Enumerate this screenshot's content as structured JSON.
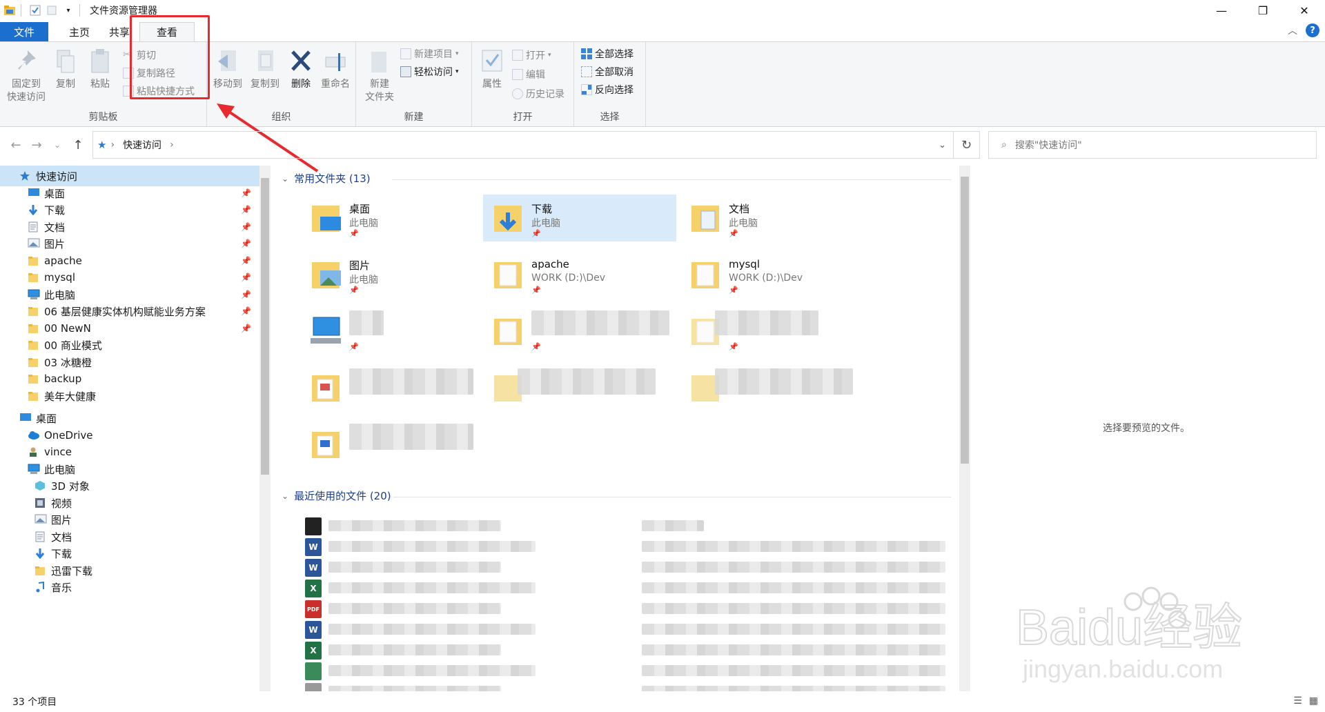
{
  "window": {
    "title": "文件资源管理器",
    "minimize": "—",
    "maximize": "❐",
    "close": "✕"
  },
  "ribbon": {
    "tabs": [
      "文件",
      "主页",
      "共享",
      "查看"
    ],
    "groups": {
      "clipboard": {
        "label": "剪贴板",
        "pin": "固定到\n快速访问",
        "pin_l1": "固定到",
        "pin_l2": "快速访问",
        "copy": "复制",
        "paste": "粘贴",
        "cut": "剪切",
        "copy_path": "复制路径",
        "paste_shortcut": "粘贴快捷方式"
      },
      "organize": {
        "label": "组织",
        "move_to": "移动到",
        "copy_to": "复制到",
        "delete": "删除",
        "rename": "重命名"
      },
      "new": {
        "label": "新建",
        "new_folder_l1": "新建",
        "new_folder_l2": "文件夹",
        "new_item": "新建项目",
        "easy_access": "轻松访问"
      },
      "open": {
        "label": "打开",
        "properties": "属性",
        "open": "打开",
        "edit": "编辑",
        "history": "历史记录"
      },
      "select": {
        "label": "选择",
        "select_all": "全部选择",
        "select_none": "全部取消",
        "invert": "反向选择"
      }
    }
  },
  "address": {
    "location": "快速访问",
    "search_placeholder": "搜索\"快速访问\""
  },
  "nav": {
    "items": [
      {
        "label": "快速访问",
        "icon": "star-icon",
        "pinned": false,
        "level": 0
      },
      {
        "label": "桌面",
        "icon": "desktop-icon",
        "pinned": true,
        "level": 1
      },
      {
        "label": "下载",
        "icon": "download-icon",
        "pinned": true,
        "level": 1
      },
      {
        "label": "文档",
        "icon": "document-icon",
        "pinned": true,
        "level": 1
      },
      {
        "label": "图片",
        "icon": "picture-icon",
        "pinned": true,
        "level": 1
      },
      {
        "label": "apache",
        "icon": "folder-icon",
        "pinned": true,
        "level": 1
      },
      {
        "label": "mysql",
        "icon": "folder-icon",
        "pinned": true,
        "level": 1
      },
      {
        "label": "此电脑",
        "icon": "computer-icon",
        "pinned": true,
        "level": 1
      },
      {
        "label": "06 基层健康实体机构赋能业务方案",
        "icon": "folder-icon",
        "pinned": true,
        "level": 1
      },
      {
        "label": "00 NewN",
        "icon": "folder-icon",
        "pinned": true,
        "level": 1
      },
      {
        "label": "00 商业模式",
        "icon": "folder-icon",
        "pinned": false,
        "level": 1
      },
      {
        "label": "03 冰糖橙",
        "icon": "folder-icon",
        "pinned": false,
        "level": 1
      },
      {
        "label": "backup",
        "icon": "folder-icon",
        "pinned": false,
        "level": 1
      },
      {
        "label": "美年大健康",
        "icon": "folder-icon",
        "pinned": false,
        "level": 1
      },
      {
        "label": "桌面",
        "icon": "desktop-icon",
        "pinned": false,
        "level": 0
      },
      {
        "label": "OneDrive",
        "icon": "cloud-icon",
        "pinned": false,
        "level": 1
      },
      {
        "label": "vince",
        "icon": "user-icon",
        "pinned": false,
        "level": 1
      },
      {
        "label": "此电脑",
        "icon": "computer-icon",
        "pinned": false,
        "level": 1
      },
      {
        "label": "3D 对象",
        "icon": "cube-icon",
        "pinned": false,
        "level": 2
      },
      {
        "label": "视频",
        "icon": "video-icon",
        "pinned": false,
        "level": 2
      },
      {
        "label": "图片",
        "icon": "picture-icon",
        "pinned": false,
        "level": 2
      },
      {
        "label": "文档",
        "icon": "document-icon",
        "pinned": false,
        "level": 2
      },
      {
        "label": "下载",
        "icon": "download-icon",
        "pinned": false,
        "level": 2
      },
      {
        "label": "迅雷下载",
        "icon": "folder-icon",
        "pinned": false,
        "level": 2
      },
      {
        "label": "音乐",
        "icon": "music-icon",
        "pinned": false,
        "level": 2
      }
    ]
  },
  "content": {
    "frequent_header": "常用文件夹 (13)",
    "recent_header": "最近使用的文件 (20)",
    "tiles": [
      {
        "name": "桌面",
        "sub": "此电脑"
      },
      {
        "name": "下载",
        "sub": "此电脑"
      },
      {
        "name": "文档",
        "sub": "此电脑"
      },
      {
        "name": "图片",
        "sub": "此电脑"
      },
      {
        "name": "apache",
        "sub": "WORK (D:)\\Dev"
      },
      {
        "name": "mysql",
        "sub": "WORK (D:)\\Dev"
      }
    ]
  },
  "preview": {
    "text": "选择要预览的文件。"
  },
  "status": {
    "count": "33 个项目"
  },
  "watermark": {
    "text": "Baidu经验",
    "url": "jingyan.baidu.com"
  }
}
